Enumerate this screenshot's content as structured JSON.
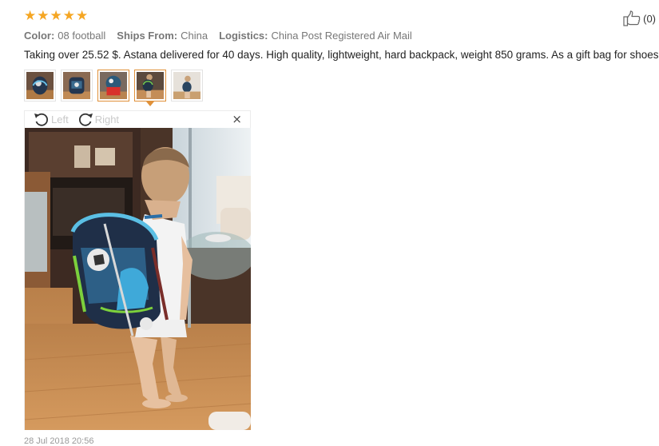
{
  "rating": {
    "stars": 5,
    "max": 5
  },
  "helpful": {
    "count_label": "(0)",
    "icon": "thumbs-up-icon"
  },
  "meta": {
    "color_key": "Color:",
    "color_value": "08 football",
    "ships_key": "Ships From:",
    "ships_value": "China",
    "logistics_key": "Logistics:",
    "logistics_value": "China Post Registered Air Mail"
  },
  "review_text": "Taking over 25.52 $. Astana delivered for 40 days. High quality, lightweight, hard backpack, weight 850 grams. As a gift bag for shoes.",
  "thumbnails": [
    {
      "name": "thumbnail-1",
      "active": false
    },
    {
      "name": "thumbnail-2",
      "active": false
    },
    {
      "name": "thumbnail-3",
      "active": true
    },
    {
      "name": "thumbnail-4",
      "active": true
    },
    {
      "name": "thumbnail-5",
      "active": false
    }
  ],
  "viewer": {
    "rotate_left_label": "Left",
    "rotate_right_label": "Right",
    "close_glyph": "×"
  },
  "date": "28 Jul 2018 20:56",
  "colors": {
    "star": "#f5a623",
    "active_border": "#e0913a"
  }
}
